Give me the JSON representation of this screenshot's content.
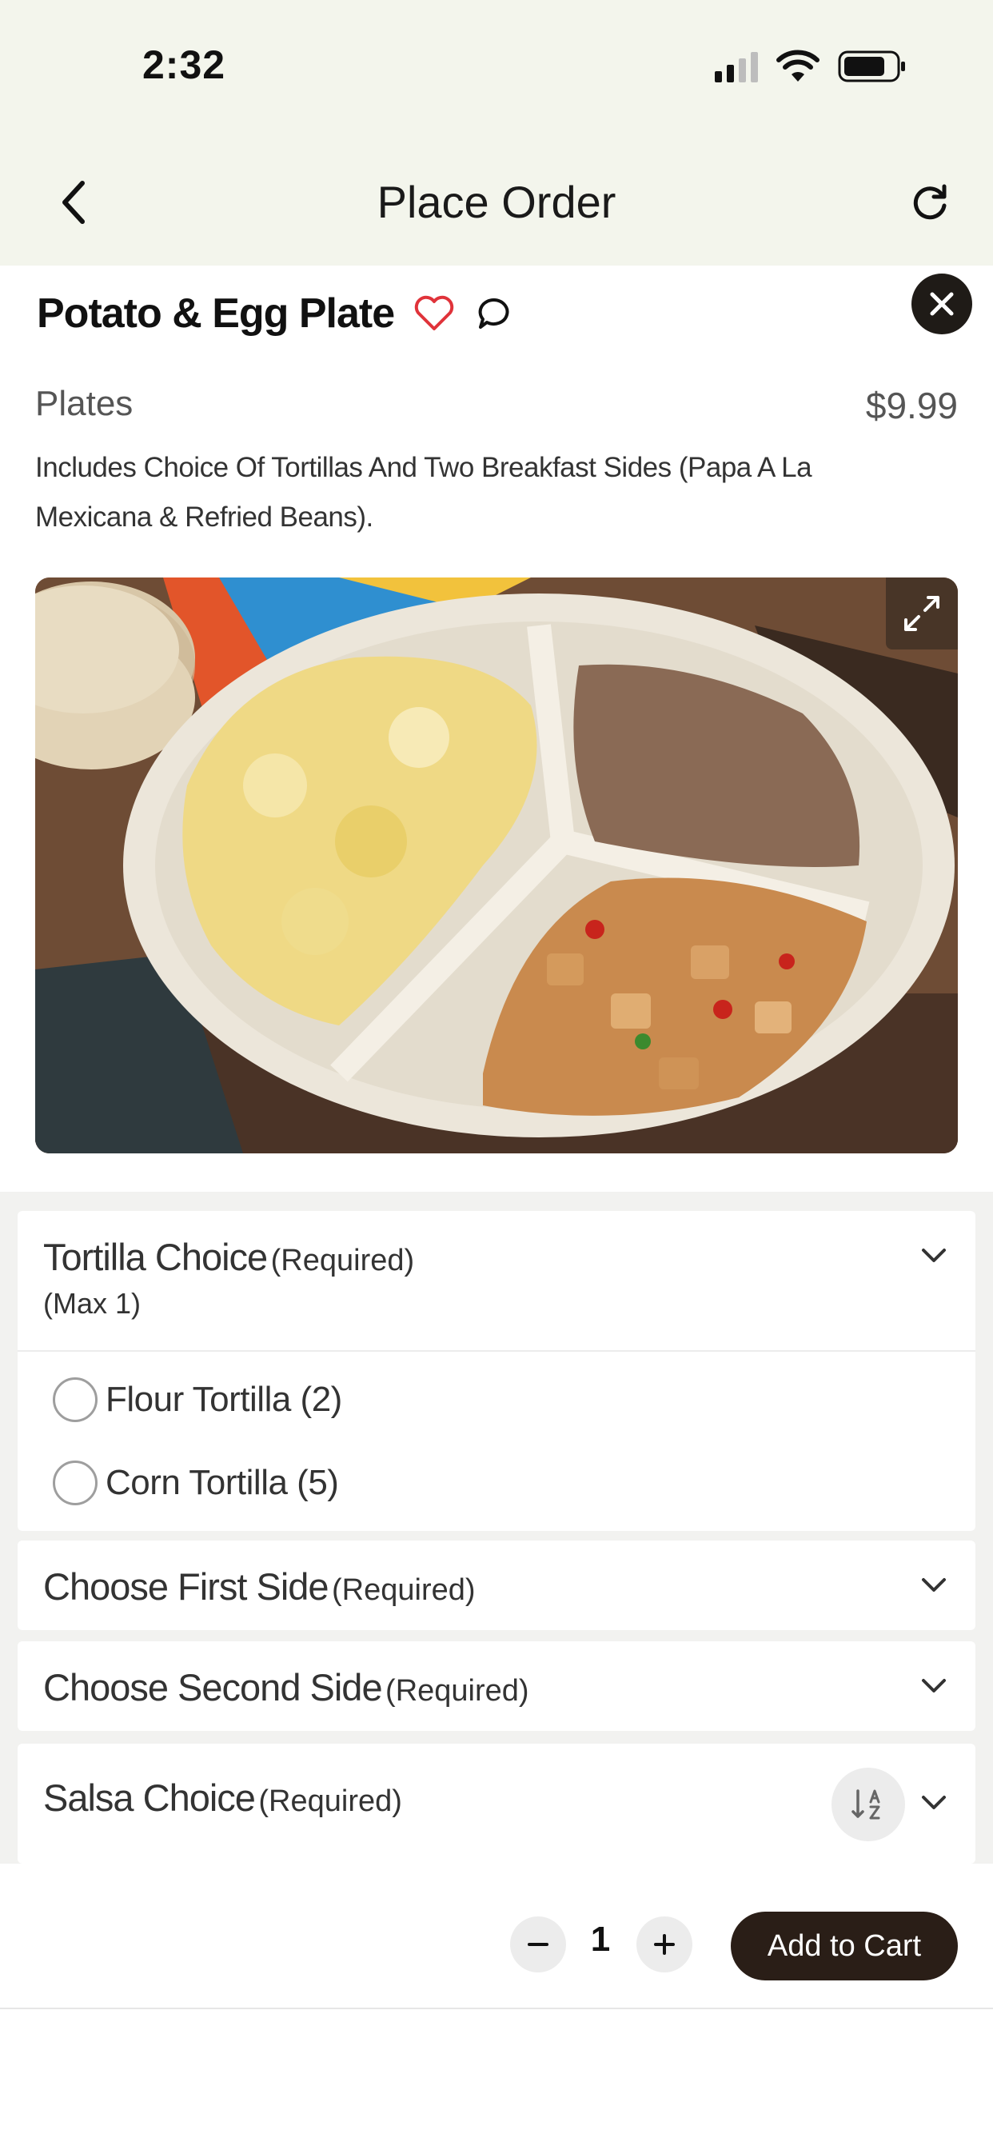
{
  "status_bar": {
    "time": "2:32"
  },
  "nav": {
    "title": "Place Order"
  },
  "item": {
    "name": "Potato & Egg Plate",
    "category": "Plates",
    "price": "$9.99",
    "description": "Includes Choice Of Tortillas And Two Breakfast Sides (Papa A La Mexicana & Refried Beans)."
  },
  "options": {
    "tortilla": {
      "title": "Tortilla Choice",
      "required": "(Required)",
      "max": "(Max 1)",
      "choices": [
        "Flour Tortilla (2)",
        "Corn Tortilla (5)"
      ]
    },
    "first_side": {
      "title": "Choose First Side",
      "required": "(Required)"
    },
    "second_side": {
      "title": "Choose Second Side",
      "required": "(Required)"
    },
    "salsa": {
      "title": "Salsa Choice",
      "required": "(Required)"
    }
  },
  "cart": {
    "quantity": "1",
    "add_label": "Add to Cart"
  },
  "icons": {
    "back": "chevron-left-icon",
    "refresh": "refresh-icon",
    "close": "close-icon",
    "favorite": "heart-outline-icon",
    "comment": "comment-bubble-icon",
    "expand": "expand-arrows-icon",
    "chevron": "chevron-down-icon",
    "sort": "sort-az-icon",
    "minus": "minus-icon",
    "plus": "plus-icon"
  },
  "colors": {
    "header_bg": "#f3f5ec",
    "accent_heart": "#e0333a",
    "button_dark": "#2a1e17"
  }
}
